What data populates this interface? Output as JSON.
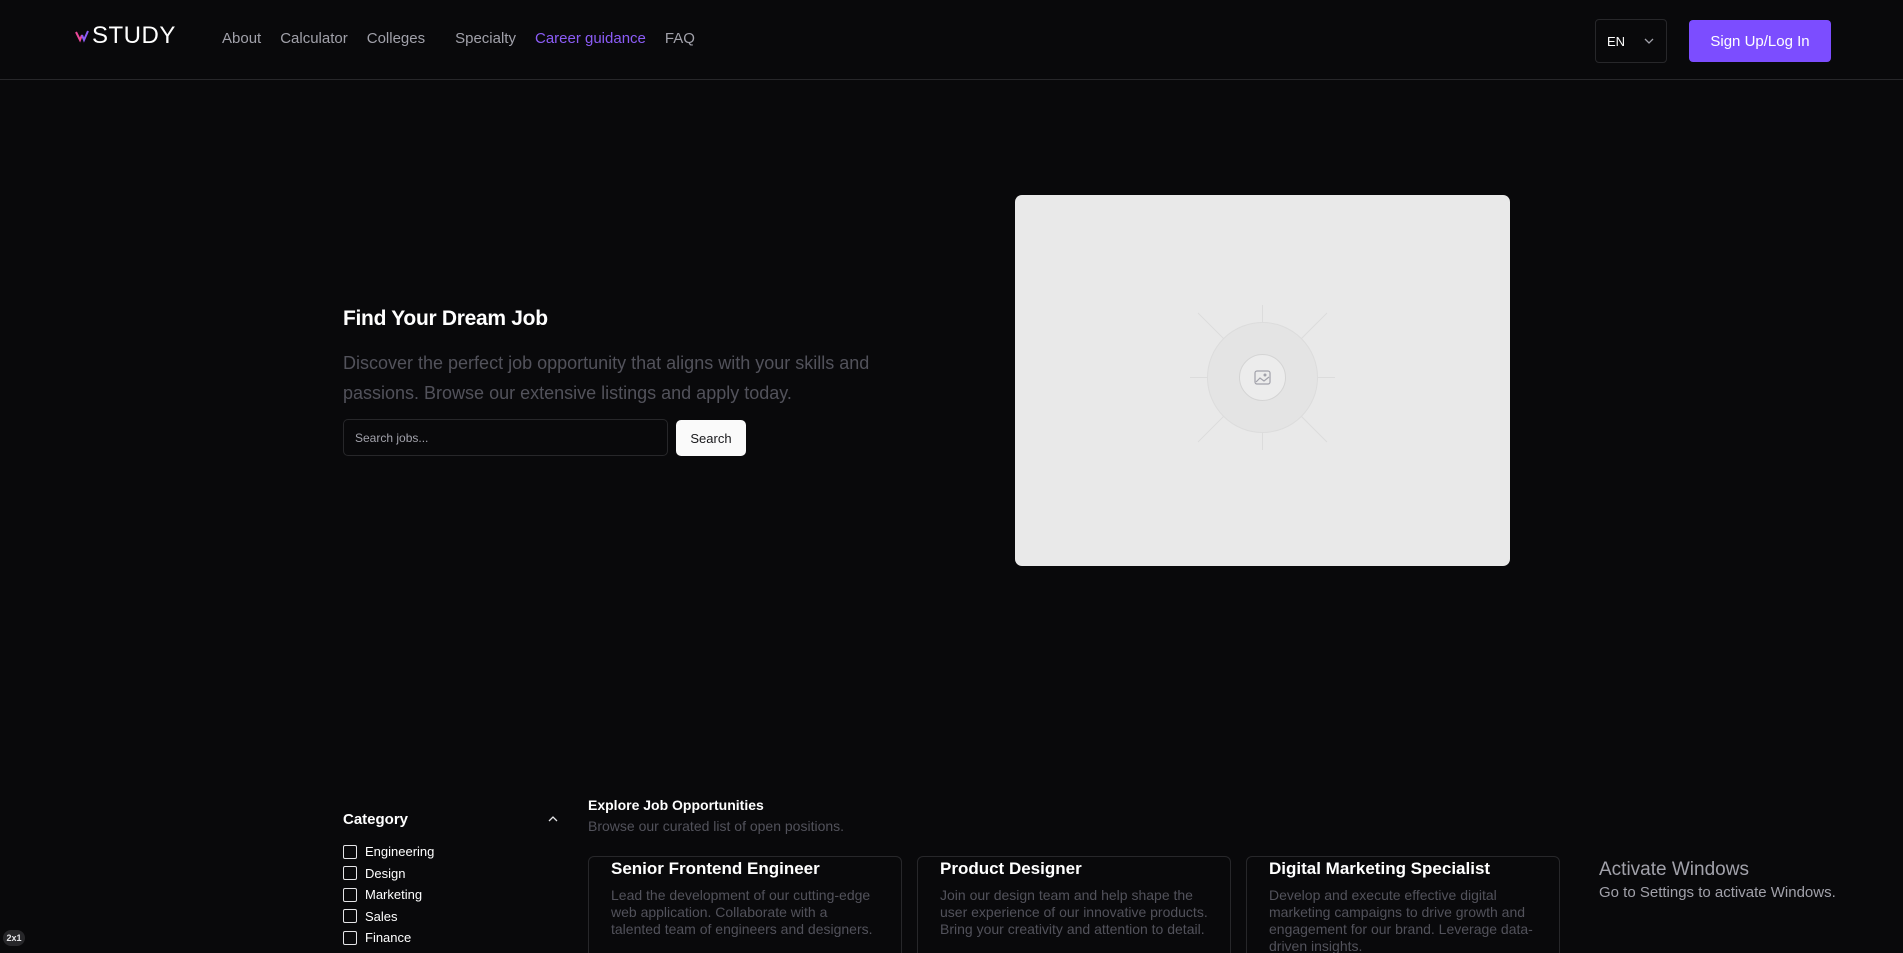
{
  "header": {
    "logo_text": "STUDY",
    "nav": [
      "About",
      "Calculator",
      "Colleges",
      "Specialty",
      "Career guidance",
      "FAQ"
    ],
    "active_nav": "Career guidance",
    "language": "EN",
    "signup_label": "Sign Up/Log In"
  },
  "hero": {
    "title": "Find Your Dream Job",
    "description": "Discover the perfect job opportunity that aligns with your skills and passions. Browse our extensive listings and apply today.",
    "search_placeholder": "Search jobs...",
    "search_button": "Search",
    "image_icon": "image-placeholder-icon"
  },
  "filters": {
    "title": "Category",
    "items": [
      "Engineering",
      "Design",
      "Marketing",
      "Sales",
      "Finance"
    ]
  },
  "jobs": {
    "title": "Explore Job Opportunities",
    "subtitle": "Browse our curated list of open positions.",
    "cards": [
      {
        "title": "Senior Frontend Engineer",
        "description": "Lead the development of our cutting-edge web application. Collaborate with a talented team of engineers and designers."
      },
      {
        "title": "Product Designer",
        "description": "Join our design team and help shape the user experience of our innovative products. Bring your creativity and attention to detail."
      },
      {
        "title": "Digital Marketing Specialist",
        "description": "Develop and execute effective digital marketing campaigns to drive growth and engagement for our brand. Leverage data-driven insights."
      }
    ]
  },
  "windows_notice": {
    "line1": "Activate Windows",
    "line2": "Go to Settings to activate Windows."
  },
  "corner_badge": "2x1",
  "colors": {
    "background": "#09090b",
    "accent": "#7c4dff",
    "active_link": "#8b5cf6",
    "muted_text": "#52525b",
    "border": "#27272a"
  }
}
